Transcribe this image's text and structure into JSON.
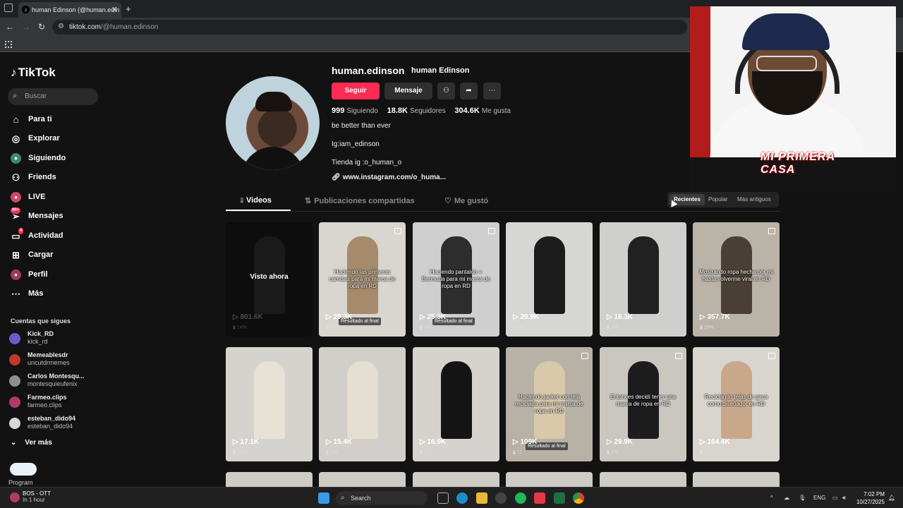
{
  "browser": {
    "tab_title": "human Edinson (@human.edin",
    "tab_close": "✕",
    "new_tab": "+",
    "url_host": "tiktok.com",
    "url_path": "/@human.edinson"
  },
  "tiktok": {
    "logo": "TikTok",
    "search_placeholder": "Buscar",
    "nav": [
      {
        "label": "Para ti",
        "icon": "home-icon"
      },
      {
        "label": "Explorar",
        "icon": "compass-icon"
      },
      {
        "label": "Siguiendo",
        "icon": "following-icon"
      },
      {
        "label": "Friends",
        "icon": "friends-icon"
      },
      {
        "label": "LIVE",
        "icon": "live-icon"
      },
      {
        "label": "Mensajes",
        "icon": "inbox-icon",
        "badge": "99+"
      },
      {
        "label": "Actividad",
        "icon": "activity-icon",
        "badge": "4"
      },
      {
        "label": "Cargar",
        "icon": "upload-icon"
      },
      {
        "label": "Perfil",
        "icon": "profile-icon"
      },
      {
        "label": "Más",
        "icon": "more-icon"
      }
    ],
    "following_title": "Cuentas que sigues",
    "following": [
      {
        "name": "Kick_RD",
        "handle": "kick_rd",
        "color": "#6a5acd"
      },
      {
        "name": "Memeablesdr",
        "handle": "uncutdrmemes",
        "color": "#c0392b"
      },
      {
        "name": "Carlos Montesqu...",
        "handle": "montesquieufenix",
        "color": "#8e8e8e"
      },
      {
        "name": "Farmeo.clips",
        "handle": "farmeo.clips",
        "color": "#b03a6b"
      },
      {
        "name": "esteban_dido94",
        "handle": "esteban_dido94",
        "color": "#d8d8d8"
      }
    ],
    "see_more": "Ver más",
    "program_label": "Program"
  },
  "profile": {
    "username": "human.edinson",
    "nickname": "human Edinson",
    "follow_btn": "Seguir",
    "message_btn": "Mensaje",
    "following_count": "999",
    "following_label": "Siguiendo",
    "followers_count": "18.8K",
    "followers_label": "Seguidores",
    "likes_count": "304.6K",
    "likes_label": "Me gusta",
    "bio_lines": [
      "be better than ever",
      "Ig:iam_edinson",
      "Tienda ig :o_human_o"
    ],
    "link": "www.instagram.com/o_huma..."
  },
  "tabs": {
    "videos": "Videos",
    "reposts": "Publicaciones compartidas",
    "liked": "Me gustó"
  },
  "sort": {
    "recent": "Recientes",
    "popular": "Popular",
    "oldest": "Más antiguos"
  },
  "videos": [
    {
      "views": "801.6K",
      "pct": "14%",
      "watched": "Visto ahora",
      "bg": "#1e1e1e",
      "fig": "#3a3a3a"
    },
    {
      "views": "29.3K",
      "pct": "5%",
      "caption": "Haciendo las primeras camisas para mi marca de ropa en RD",
      "pill": "Resultado al final",
      "multi": true,
      "bg": "#d9d5cf",
      "fig": "#a58a6b"
    },
    {
      "views": "25.3K",
      "pct": "3%",
      "caption": "Haciendo pantalón + Bermuda para mi marca de ropa en RD",
      "pill": "Resultado al final",
      "multi": true,
      "bg": "#cfcfcf",
      "fig": "#2d2d2d"
    },
    {
      "views": "20.9K",
      "pct": "8%",
      "bg": "#d6d6d4",
      "fig": "#1c1c1c"
    },
    {
      "views": "16.3K",
      "pct": "3%",
      "bg": "#cfcfcd",
      "fig": "#222"
    },
    {
      "views": "357.7K",
      "pct": "19%",
      "caption": "Mostrando ropa hecha por mi hasta volverme viral en RD",
      "multi": true,
      "bg": "#b9b3a8",
      "fig": "#4a3f36"
    },
    {
      "views": "17.1K",
      "pct": "10%",
      "bg": "#d5d3ce",
      "fig": "#e8e2d6"
    },
    {
      "views": "15.4K",
      "pct": "7%",
      "bg": "#d2cfca",
      "fig": "#e5dfd2"
    },
    {
      "views": "16.9K",
      "pct": "7%",
      "bg": "#d6d3cf",
      "fig": "#141414"
    },
    {
      "views": "109K",
      "pct": "11",
      "caption": "Haciendo jacket con tela reciclada para mi marca de ropa en RD",
      "pill": "Resultado al final",
      "multi": true,
      "bg": "#b7b1a6",
      "fig": "#d9c8aa"
    },
    {
      "views": "29.9K",
      "pct": "9%",
      "caption": "Entonces decidí tener una marca de ropa en RD",
      "multi": true,
      "bg": "#cac7c1",
      "fig": "#1d1d1d"
    },
    {
      "views": "164.4K",
      "pct": "12%",
      "caption": "Reciclando telas de paca como diseñador en RD",
      "multi": true,
      "bg": "#d8d4ce",
      "fig": "#c9a78a"
    }
  ],
  "taskbar": {
    "notif_title": "BOS - OTT",
    "notif_sub": "In 1 hour",
    "search": "Search",
    "lang": "ENG",
    "time": "7:02 PM",
    "date": "10/27/2025"
  },
  "overlay": {
    "brand": "MI PRIMERA CASA"
  },
  "colors": {
    "accent": "#fe2c55",
    "bg": "#121212"
  }
}
